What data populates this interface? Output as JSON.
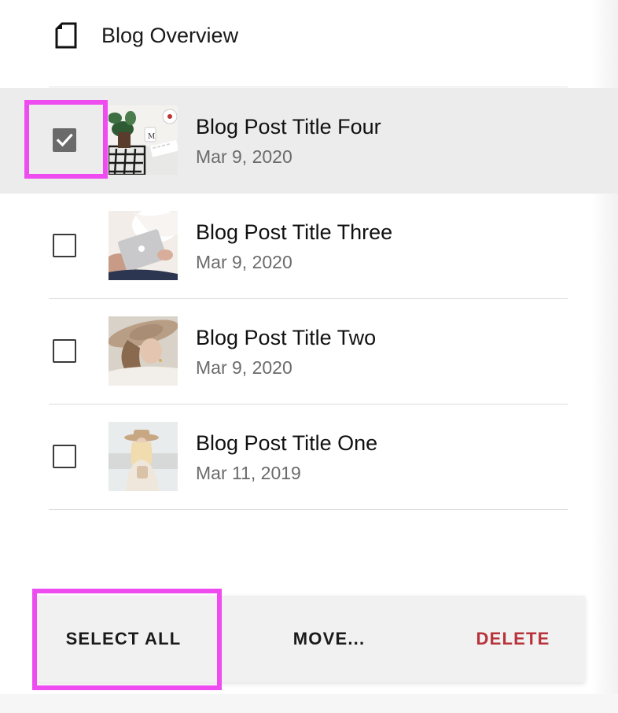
{
  "header": {
    "title": "Blog Overview",
    "icon": "page-icon"
  },
  "posts": [
    {
      "title": "Blog Post Title Four",
      "date": "Mar 9, 2020",
      "checked": true,
      "thumbnail": "desk-workspace-thumbnail"
    },
    {
      "title": "Blog Post Title Three",
      "date": "Mar 9, 2020",
      "checked": false,
      "thumbnail": "laptop-thumbnail"
    },
    {
      "title": "Blog Post Title Two",
      "date": "Mar 9, 2020",
      "checked": false,
      "thumbnail": "hat-woman-thumbnail"
    },
    {
      "title": "Blog Post Title One",
      "date": "Mar 11, 2019",
      "checked": false,
      "thumbnail": "woman-portrait-thumbnail"
    }
  ],
  "actions": {
    "select_all": "SELECT ALL",
    "move": "MOVE...",
    "delete": "DELETE"
  },
  "colors": {
    "selected_row": "#ececec",
    "checked_box": "#6a6a6a",
    "delete_text": "#b8323a",
    "highlight": "#ee4bf0",
    "action_bar": "#f1f1f1"
  }
}
